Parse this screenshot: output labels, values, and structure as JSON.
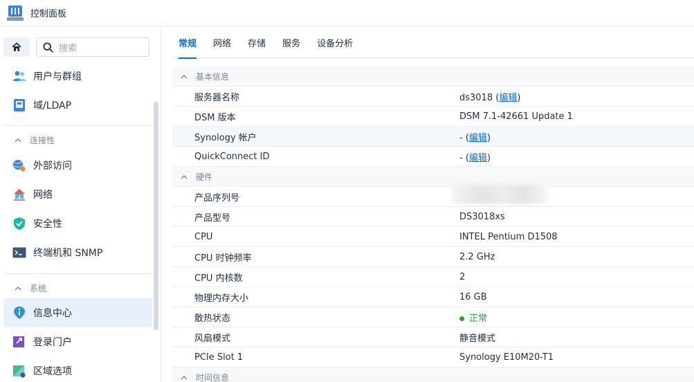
{
  "window": {
    "title": "控制面板"
  },
  "sidebar": {
    "search_placeholder": "搜索",
    "items_top": [
      {
        "label": "用户与群组",
        "icon": "users-icon"
      },
      {
        "label": "域/LDAP",
        "icon": "ldap-icon"
      }
    ],
    "sections": [
      {
        "title": "连接性",
        "items": [
          {
            "label": "外部访问",
            "icon": "external-access-icon"
          },
          {
            "label": "网络",
            "icon": "network-icon"
          },
          {
            "label": "安全性",
            "icon": "shield-icon"
          },
          {
            "label": "终端机和 SNMP",
            "icon": "terminal-icon"
          }
        ]
      },
      {
        "title": "系统",
        "items": [
          {
            "label": "信息中心",
            "icon": "info-icon",
            "active": true
          },
          {
            "label": "登录门户",
            "icon": "login-portal-icon"
          },
          {
            "label": "区域选项",
            "icon": "region-icon"
          }
        ]
      }
    ]
  },
  "tabs": [
    "常规",
    "网络",
    "存储",
    "服务",
    "设备分析"
  ],
  "info": {
    "basic_title": "基本信息",
    "server_name_label": "服务器名称",
    "server_name_value": "ds3018",
    "edit_label": "编辑",
    "dsm_label": "DSM 版本",
    "dsm_value": "DSM 7.1-42661 Update 1",
    "synology_account_label": "Synology 帐户",
    "dash": "-",
    "quickconnect_label": "QuickConnect ID",
    "hardware_title": "硬件",
    "serial_label": "产品序列号",
    "model_label": "产品型号",
    "model_value": "DS3018xs",
    "cpu_label": "CPU",
    "cpu_value": "INTEL Pentium D1508",
    "cpu_clock_label": "CPU 时钟频率",
    "cpu_clock_value": "2.2 GHz",
    "cpu_cores_label": "CPU 内核数",
    "cpu_cores_value": "2",
    "memory_label": "物理内存大小",
    "memory_value": "16 GB",
    "thermal_label": "散热状态",
    "thermal_value": "正常",
    "fan_label": "风扇模式",
    "fan_value": "静音模式",
    "pcie_label": "PCIe Slot 1",
    "pcie_value": "Synology E10M20-T1",
    "time_title": "时间信息"
  },
  "colors": {
    "accent": "#0a6fd1",
    "ok": "#2aa13a"
  }
}
